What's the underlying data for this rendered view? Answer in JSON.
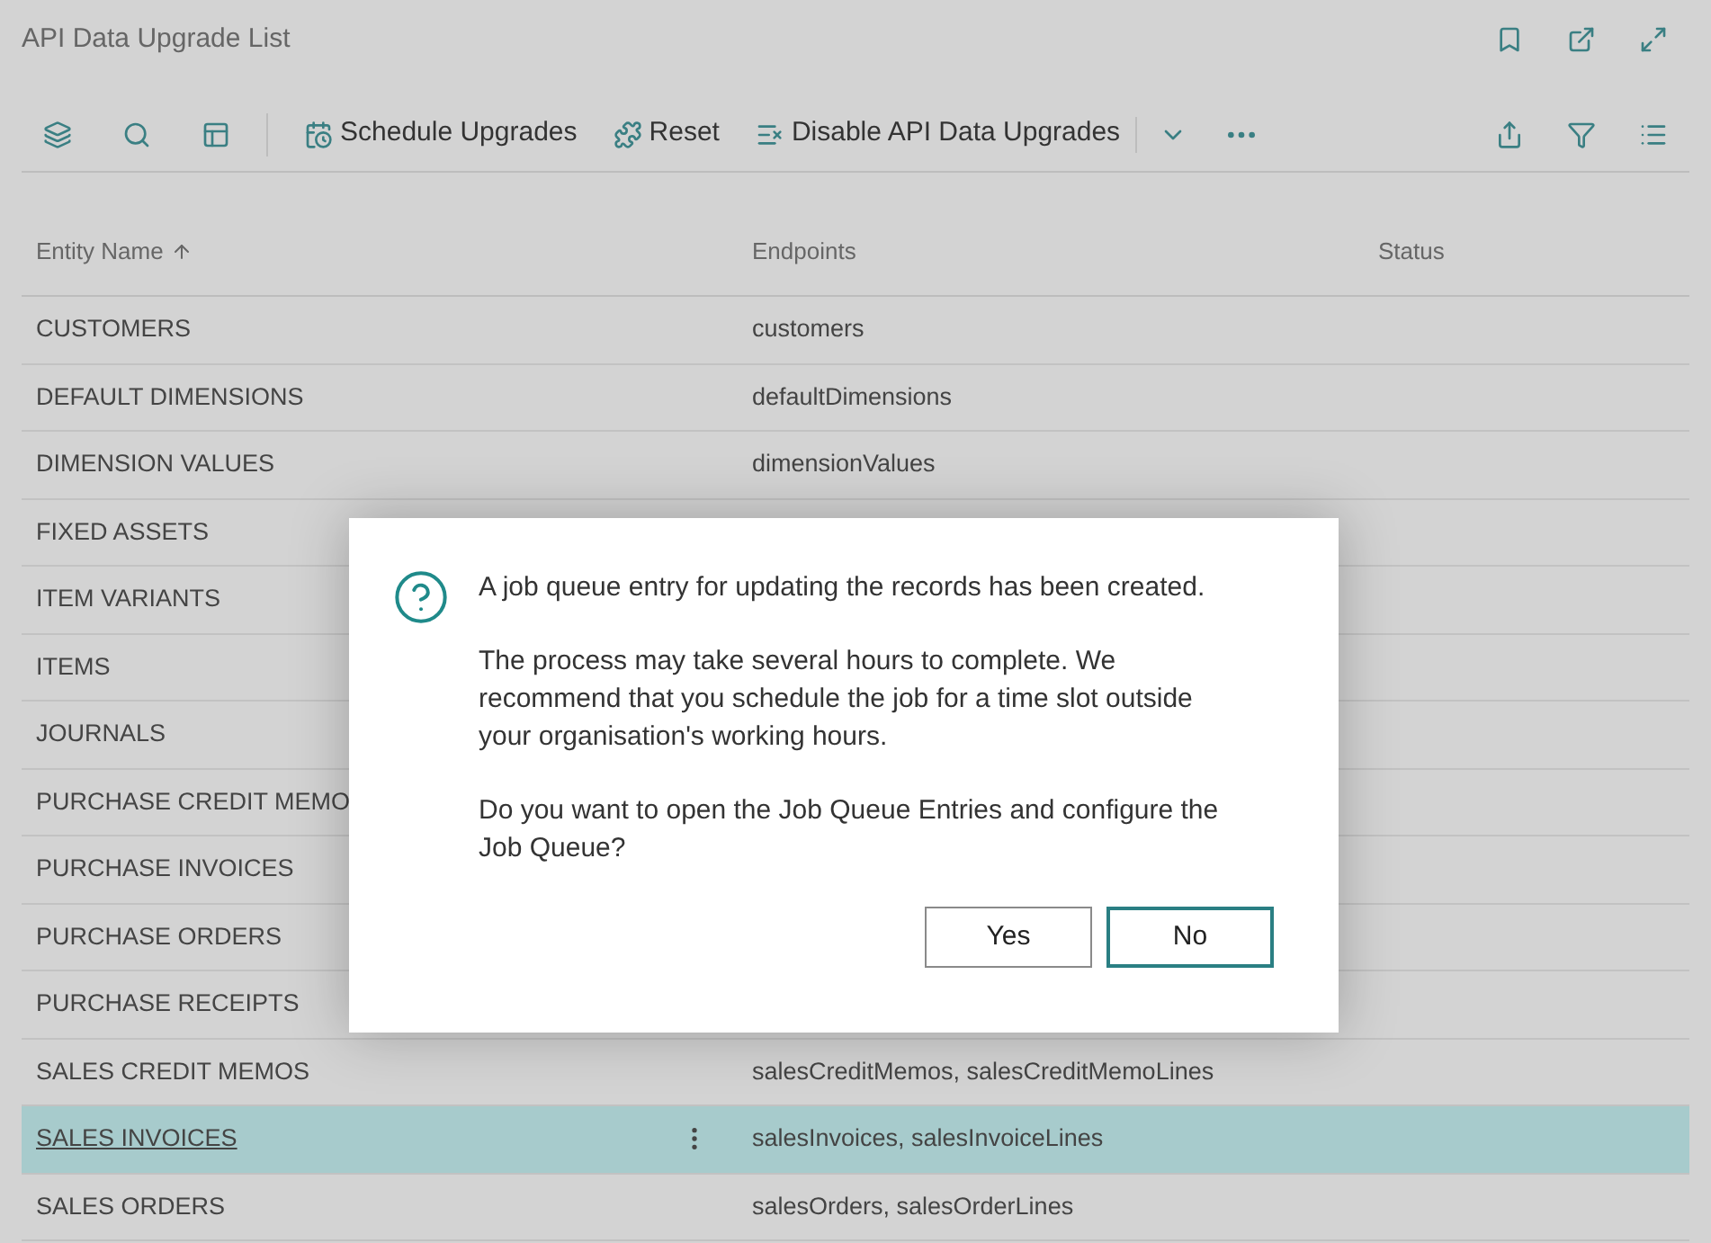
{
  "window": {
    "title": "API Data Upgrade List"
  },
  "toolbar": {
    "actions": [
      {
        "kind": "schedule",
        "label": "Schedule Upgrades"
      },
      {
        "kind": "reset",
        "label": "Reset"
      },
      {
        "kind": "disable",
        "label": "Disable API Data Upgrades"
      }
    ]
  },
  "table": {
    "columns": [
      "Entity Name",
      "Endpoints",
      "Status"
    ],
    "rows": [
      {
        "entity": "CUSTOMERS",
        "endpoints": "customers",
        "selected": false
      },
      {
        "entity": "DEFAULT DIMENSIONS",
        "endpoints": "defaultDimensions",
        "selected": false
      },
      {
        "entity": "DIMENSION VALUES",
        "endpoints": "dimensionValues",
        "selected": false
      },
      {
        "entity": "FIXED ASSETS",
        "selected": false
      },
      {
        "entity": "ITEM VARIANTS",
        "selected": false
      },
      {
        "entity": "ITEMS",
        "selected": false
      },
      {
        "entity": "JOURNALS",
        "selected": false
      },
      {
        "entity": "PURCHASE CREDIT MEMO",
        "selected": false
      },
      {
        "entity": "PURCHASE INVOICES",
        "selected": false
      },
      {
        "entity": "PURCHASE ORDERS",
        "selected": false
      },
      {
        "entity": "PURCHASE RECEIPTS",
        "selected": false
      },
      {
        "entity": "SALES CREDIT MEMOS",
        "endpoints": "salesCreditMemos, salesCreditMemoLines",
        "selected": false
      },
      {
        "entity": "SALES INVOICES",
        "endpoints": "salesInvoices, salesInvoiceLines",
        "selected": true
      },
      {
        "entity": "SALES ORDERS",
        "endpoints": "salesOrders, salesOrderLines",
        "selected": false
      }
    ]
  },
  "dialog": {
    "paragraphs": [
      "A job queue entry for updating the records has been created.",
      "The process may take several hours to complete. We recommend that you schedule the job for a time slot outside your organisation's working hours.",
      "Do you want to open the Job Queue Entries and configure the Job Queue?"
    ],
    "buttons": [
      {
        "label": "Yes",
        "selected": false
      },
      {
        "label": "No",
        "selected": true
      }
    ]
  }
}
